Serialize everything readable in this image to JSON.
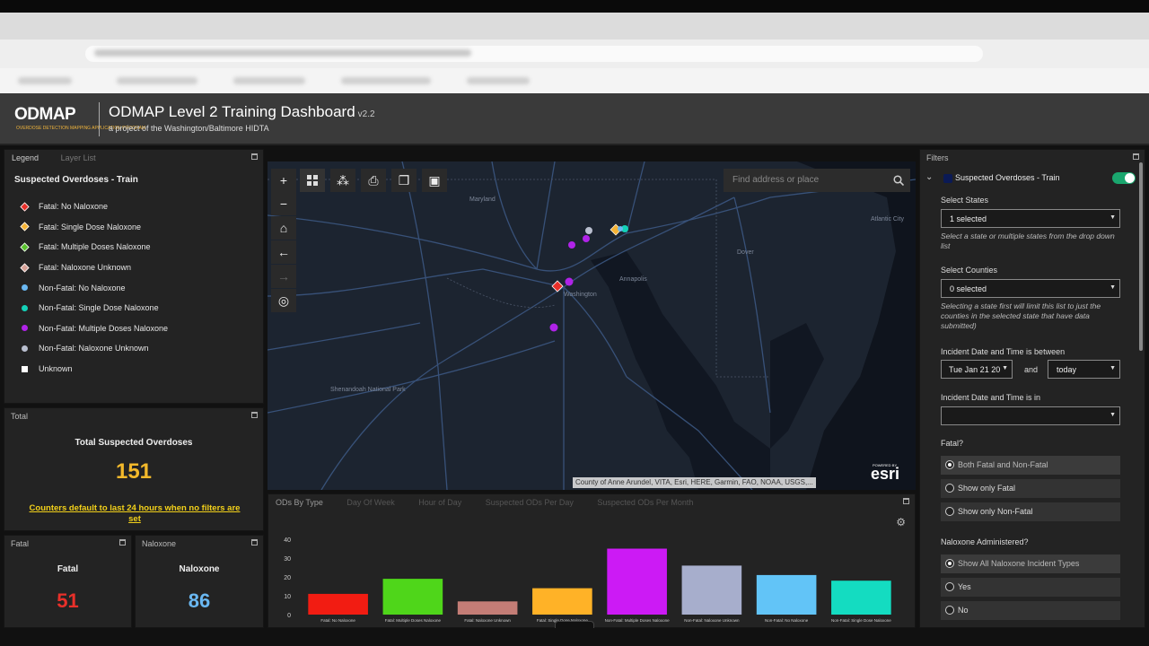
{
  "app": {
    "logo": "ODMAP",
    "logo_sub": "OVERDOSE DETECTION MAPPING APPLICATION PROGRAM",
    "title": "ODMAP Level 2 Training Dashboard",
    "version": "v2.2",
    "subtitle": "a project of the Washington/Baltimore HIDTA"
  },
  "legend_panel": {
    "tabs": [
      "Legend",
      "Layer List"
    ],
    "layer_title": "Suspected Overdoses - Train",
    "items": [
      {
        "label": "Fatal: No Naloxone",
        "shape": "diamond",
        "color": "#e8302a"
      },
      {
        "label": "Fatal: Single Dose Naloxone",
        "shape": "diamond",
        "color": "#f5b335"
      },
      {
        "label": "Fatal: Multiple Doses Naloxone",
        "shape": "diamond",
        "color": "#59c22e"
      },
      {
        "label": "Fatal: Naloxone Unknown",
        "shape": "diamond",
        "color": "#d7a197"
      },
      {
        "label": "Non-Fatal: No Naloxone",
        "shape": "circle",
        "color": "#6ab8f2"
      },
      {
        "label": "Non-Fatal: Single Dose Naloxone",
        "shape": "circle",
        "color": "#14d1b8"
      },
      {
        "label": "Non-Fatal: Multiple Doses Naloxone",
        "shape": "circle",
        "color": "#b023e8"
      },
      {
        "label": "Non-Fatal: Naloxone Unknown",
        "shape": "circle",
        "color": "#b9bfcf"
      },
      {
        "label": "Unknown",
        "shape": "square",
        "color": "#ffffff"
      }
    ]
  },
  "total_panel": {
    "label": "Total",
    "heading": "Total Suspected Overdoses",
    "value": "151",
    "note": "Counters default to last 24 hours when no filters are set"
  },
  "fatal_panel": {
    "label": "Fatal",
    "heading": "Fatal",
    "value": "51",
    "color": "#e8302a"
  },
  "naloxone_panel": {
    "label": "Naloxone",
    "heading": "Naloxone",
    "value": "86",
    "color": "#6ab8f2"
  },
  "map": {
    "search_placeholder": "Find address or place",
    "attribution": "County of Anne Arundel, VITA, Esri, HERE, Garmin, FAO, NOAA, USGS,...",
    "esri_powered": "POWERED BY",
    "esri_logo": "esri",
    "place_labels": [
      "Maryland",
      "Washington",
      "Annapolis",
      "Dover",
      "Atlantic City",
      "Shenandoah National Park"
    ]
  },
  "chart_panel": {
    "tabs": [
      "ODs By Type",
      "Day Of Week",
      "Hour of Day",
      "Suspected ODs Per Day",
      "Suspected ODs Per Month"
    ]
  },
  "chart_data": {
    "type": "bar",
    "categories": [
      "Fatal: No Naloxone",
      "Fatal: Multiple Doses Naloxone",
      "Fatal: Naloxone Unknown",
      "Fatal: Single Dose Naloxone",
      "Non-Fatal: Multiple Doses Naloxone",
      "Non-Fatal: Naloxone Unknown",
      "Non-Fatal: No Naloxone",
      "Non-Fatal: Single Dose Naloxone"
    ],
    "values": [
      11,
      19,
      7,
      14,
      35,
      26,
      21,
      18
    ],
    "colors": [
      "#f21c12",
      "#4fd61a",
      "#c47d76",
      "#ffb227",
      "#cc1af5",
      "#a7aecc",
      "#62c4f7",
      "#14dcc1"
    ],
    "ylim": [
      0,
      40
    ],
    "yticks": [
      0,
      10,
      20,
      30,
      40
    ],
    "grid": false,
    "legend": "none"
  },
  "filters": {
    "label": "Filters",
    "layer_name": "Suspected Overdoses - Train",
    "states_label": "Select States",
    "states_value": "1 selected",
    "states_help": "Select a state or multiple states from the drop down list",
    "counties_label": "Select Counties",
    "counties_value": "0 selected",
    "counties_help": "Selecting a state first will limit this list to just the counties in the selected state that have data submitted)",
    "date_between_label": "Incident Date and Time is between",
    "date_from": "Tue Jan 21 20",
    "date_and": "and",
    "date_to": "today",
    "date_in_label": "Incident Date and Time is in",
    "date_in_value": "",
    "fatal_label": "Fatal?",
    "fatal_options": [
      "Both Fatal and Non-Fatal",
      "Show only Fatal",
      "Show only Non-Fatal"
    ],
    "naloxone_label": "Naloxone Administered?",
    "naloxone_options": [
      "Show All Naloxone Incident Types",
      "Yes",
      "No"
    ]
  }
}
